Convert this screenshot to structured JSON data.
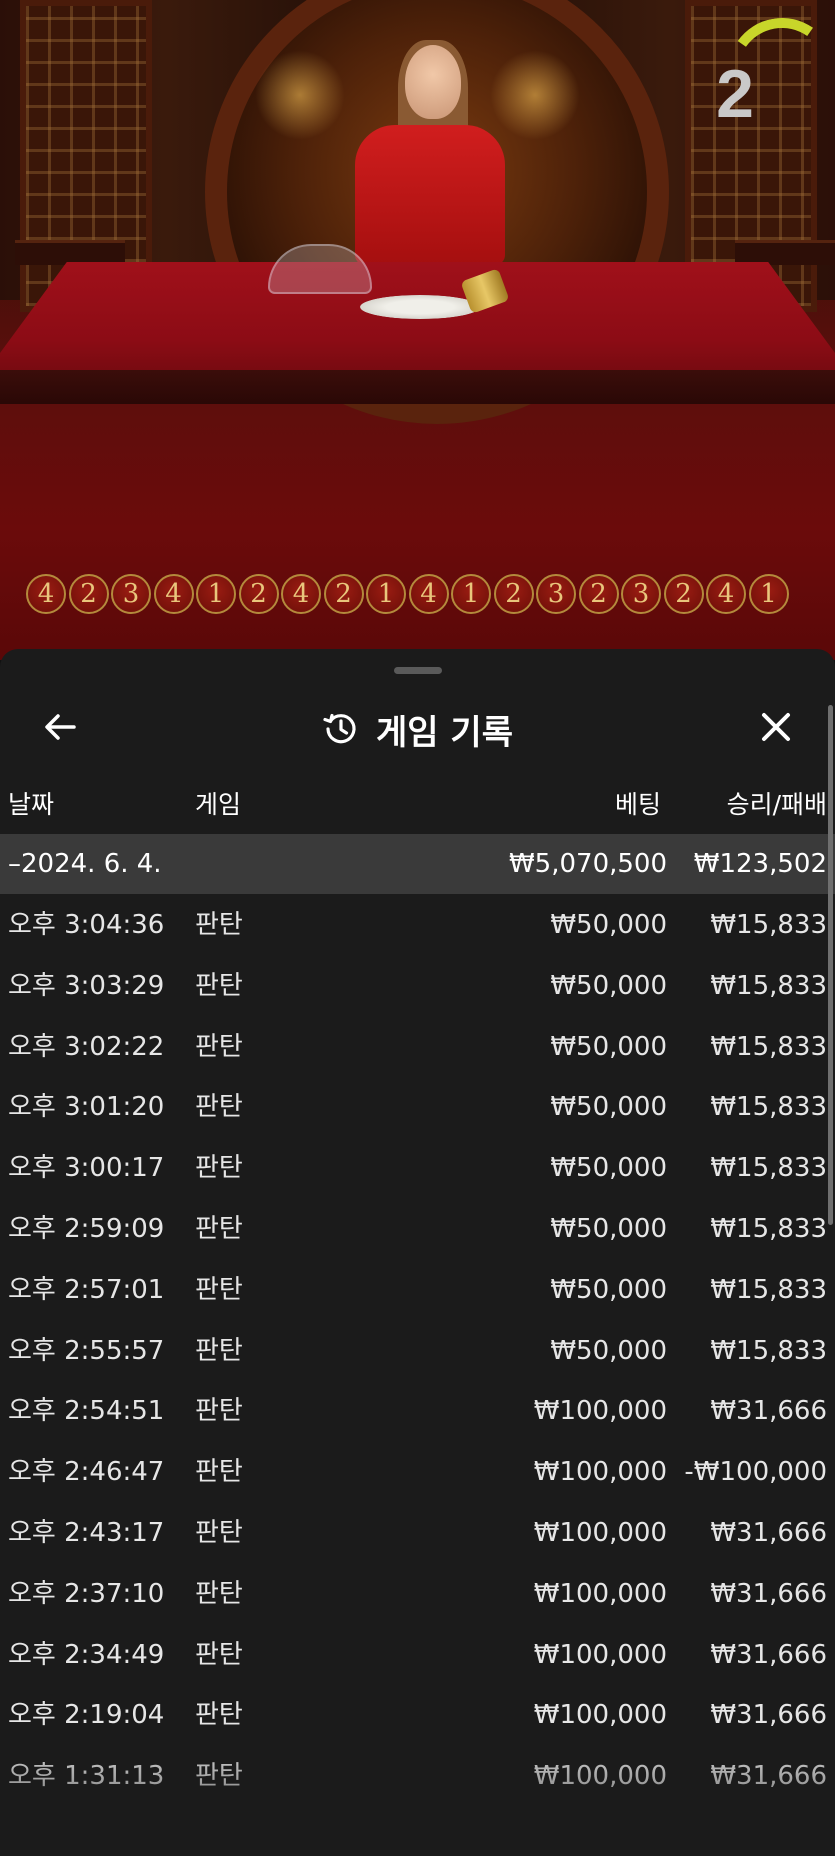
{
  "stream": {
    "countdown": "2",
    "roadmap": [
      "4",
      "2",
      "3",
      "4",
      "1",
      "2",
      "4",
      "2",
      "1",
      "4",
      "1",
      "2",
      "3",
      "2",
      "3",
      "2",
      "4",
      "1"
    ]
  },
  "history": {
    "title": "게임 기록",
    "icons": {
      "back": "back-arrow-icon",
      "title": "history-icon",
      "close": "close-icon"
    },
    "columns": {
      "date": "날짜",
      "game": "게임",
      "bet": "베팅",
      "result": "승리/패배"
    },
    "summary": {
      "date": "–2024. 6. 4.",
      "bet": "₩5,070,500",
      "result": "₩123,502"
    },
    "rows": [
      {
        "time": "오후 3:04:36",
        "game": "판탄",
        "bet": "₩50,000",
        "result": "₩15,833"
      },
      {
        "time": "오후 3:03:29",
        "game": "판탄",
        "bet": "₩50,000",
        "result": "₩15,833"
      },
      {
        "time": "오후 3:02:22",
        "game": "판탄",
        "bet": "₩50,000",
        "result": "₩15,833"
      },
      {
        "time": "오후 3:01:20",
        "game": "판탄",
        "bet": "₩50,000",
        "result": "₩15,833"
      },
      {
        "time": "오후 3:00:17",
        "game": "판탄",
        "bet": "₩50,000",
        "result": "₩15,833"
      },
      {
        "time": "오후 2:59:09",
        "game": "판탄",
        "bet": "₩50,000",
        "result": "₩15,833"
      },
      {
        "time": "오후 2:57:01",
        "game": "판탄",
        "bet": "₩50,000",
        "result": "₩15,833"
      },
      {
        "time": "오후 2:55:57",
        "game": "판탄",
        "bet": "₩50,000",
        "result": "₩15,833"
      },
      {
        "time": "오후 2:54:51",
        "game": "판탄",
        "bet": "₩100,000",
        "result": "₩31,666"
      },
      {
        "time": "오후 2:46:47",
        "game": "판탄",
        "bet": "₩100,000",
        "result": "-₩100,000"
      },
      {
        "time": "오후 2:43:17",
        "game": "판탄",
        "bet": "₩100,000",
        "result": "₩31,666"
      },
      {
        "time": "오후 2:37:10",
        "game": "판탄",
        "bet": "₩100,000",
        "result": "₩31,666"
      },
      {
        "time": "오후 2:34:49",
        "game": "판탄",
        "bet": "₩100,000",
        "result": "₩31,666"
      },
      {
        "time": "오후 2:19:04",
        "game": "판탄",
        "bet": "₩100,000",
        "result": "₩31,666"
      },
      {
        "time": "오후 1:31:13",
        "game": "판탄",
        "bet": "₩100,000",
        "result": "₩31,666"
      }
    ]
  },
  "colors": {
    "panel_bg": "#1b1b1b",
    "summary_bg": "#3a3a3a",
    "text": "#e6e6e6",
    "timer_arc": "#c8d62a",
    "roadmap_gold": "#e9c67c"
  }
}
